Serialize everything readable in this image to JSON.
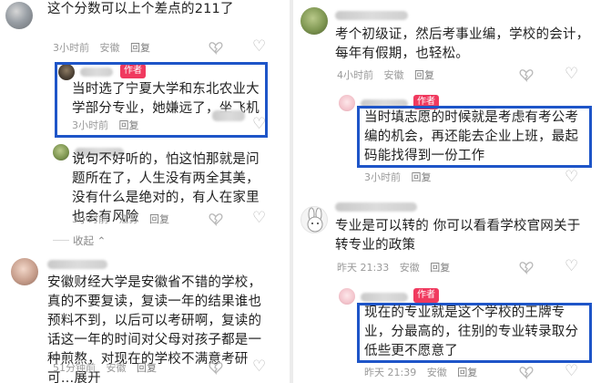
{
  "left": {
    "c1": {
      "text": "这个分数可以上个差点的211了",
      "time": "3小时前",
      "location": "安徽",
      "reply": "回复"
    },
    "r1": {
      "tag": "作者",
      "text": "当时选了宁夏大学和东北农业大学部分专业，她嫌远了，坐飞机",
      "time": "3小时前",
      "reply": "回复"
    },
    "r2": {
      "text": "说句不好听的，怕这怕那就是问题所在了，人生没有两全其美，没有什么是绝对的，有人在家里也会有风险",
      "time": "3小时前",
      "location": "江苏",
      "reply": "回复"
    },
    "collapse": "收起 ⌃",
    "c2": {
      "text": "安徽财经大学是安徽省不错的学校，真的不要复读，复读一年的结果谁也预料不到，以后可以考研啊，复读的话这一年的时间对父母对孩子都是一种煎熬，对现在的学校不满意考研可…展开",
      "time": "51分钟前",
      "location": "安徽",
      "reply": "回复"
    }
  },
  "right": {
    "c1": {
      "text": "考个初级证，然后考事业编，学校的会计，每年有假期，也轻松。",
      "time": "4小时前",
      "location": "安徽",
      "reply": "回复"
    },
    "r1": {
      "tag": "作者",
      "text": "当时填志愿的时候就是考虑有考公考编的机会，再还能去企业上班，最起码能找得到一份工作",
      "time": "3小时前",
      "reply": "回复"
    },
    "c2": {
      "text": "专业是可以转的 你可以看看学校官网关于转专业的政策",
      "time": "昨天 21:33",
      "location": "安徽",
      "reply": "回复"
    },
    "r2": {
      "tag": "作者",
      "text": "现在的专业就是这个学校的王牌专业，分最高的，往别的专业转录取分低些更不愿意了",
      "time": "昨天 21:39",
      "location": "安徽",
      "reply": "回复"
    }
  },
  "icons": {
    "like": "heart-outline-icon",
    "dislike": "broken-heart-icon"
  },
  "colors": {
    "highlight": "#1e55c8",
    "author_tag": "#f03a5f",
    "meta": "#9a9a9a"
  }
}
